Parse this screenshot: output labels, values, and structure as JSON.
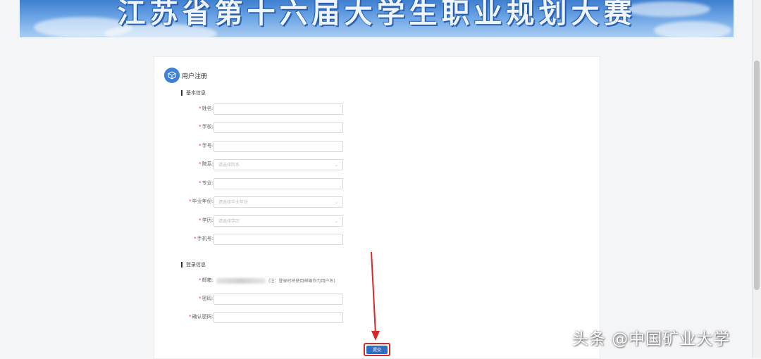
{
  "banner": {
    "title": "江苏省第十六届大学生职业规划大赛"
  },
  "form": {
    "title": "用户注册",
    "sections": {
      "basic": "基本信息",
      "login": "登录信息"
    },
    "fields": {
      "name": {
        "label": "姓名:",
        "value": ""
      },
      "school": {
        "label": "学校:",
        "value": ""
      },
      "student_id": {
        "label": "学号:",
        "value": ""
      },
      "department": {
        "label": "院系:",
        "placeholder": "请选择院系"
      },
      "major": {
        "label": "专业:",
        "value": ""
      },
      "grad_year": {
        "label": "毕业年份:",
        "placeholder": "请选择毕业年份"
      },
      "degree": {
        "label": "学历:",
        "placeholder": "请选择学历"
      },
      "phone": {
        "label": "手机号:",
        "value": ""
      },
      "email": {
        "label": "邮箱:",
        "note": "(注：登录时将使用邮箱作为用户名)"
      },
      "password": {
        "label": "密码:",
        "value": ""
      },
      "confirm_password": {
        "label": "确认密码:",
        "value": ""
      }
    },
    "required_mark": "*",
    "submit_label": "提交"
  },
  "watermark": "头条 @中国矿业大学",
  "colors": {
    "accent": "#3d80d6",
    "button": "#2f6fc2",
    "highlight": "#d42a2a"
  },
  "icons": {
    "header": "cube-icon",
    "select": "chevron-down-icon"
  }
}
